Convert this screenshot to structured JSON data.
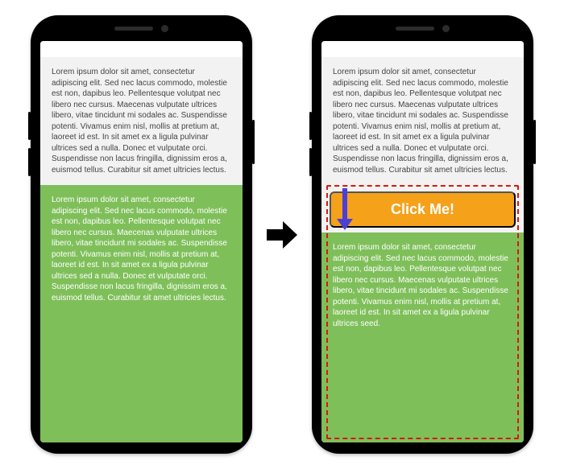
{
  "paragraph_a": "Lorem ipsum dolor sit amet, consectetur adipiscing elit. Sed nec lacus commodo, molestie est non, dapibus leo. Pellentesque volutpat nec libero nec cursus. Maecenas vulputate ultrices libero, vitae tincidunt mi sodales ac. Suspendisse potenti. Vivamus enim nisl, mollis at pretium at, laoreet id est. In sit amet ex a ligula pulvinar ultrices sed a nulla. Donec et vulputate orci. Suspendisse non lacus fringilla, dignissim eros a, euismod tellus. Curabitur sit amet ultricies lectus.",
  "paragraph_b": "Lorem ipsum dolor sit amet, consectetur adipiscing elit. Sed nec lacus commodo, molestie est non, dapibus leo. Pellentesque volutpat nec libero nec cursus. Maecenas vulputate ultrices libero, vitae tincidunt mi sodales ac. Suspendisse potenti. Vivamus enim nisl, mollis at pretium at, laoreet id est. In sit amet ex a ligula pulvinar ultrices sed a nulla. Donec et vulputate orci. Suspendisse non lacus fringilla, dignissim eros a, euismod tellus. Curabitur sit amet ultricies lectus.",
  "paragraph_b_truncated": "Lorem ipsum dolor sit amet, consectetur adipiscing elit. Sed nec lacus commodo, molestie est non, dapibus leo. Pellentesque volutpat nec libero nec cursus. Maecenas vulputate ultrices libero, vitae tincidunt mi sodales ac. Suspendisse potenti. Vivamus enim nisl, mollis at pretium at, laoreet id est. In sit amet ex a ligula pulvinar ultrices seed.",
  "banner_label": "Click Me!",
  "colors": {
    "banner": "#f5a11a",
    "green_block": "#7fbf5a",
    "highlight_border": "#d9180f",
    "push_arrow": "#4b3fd6"
  }
}
